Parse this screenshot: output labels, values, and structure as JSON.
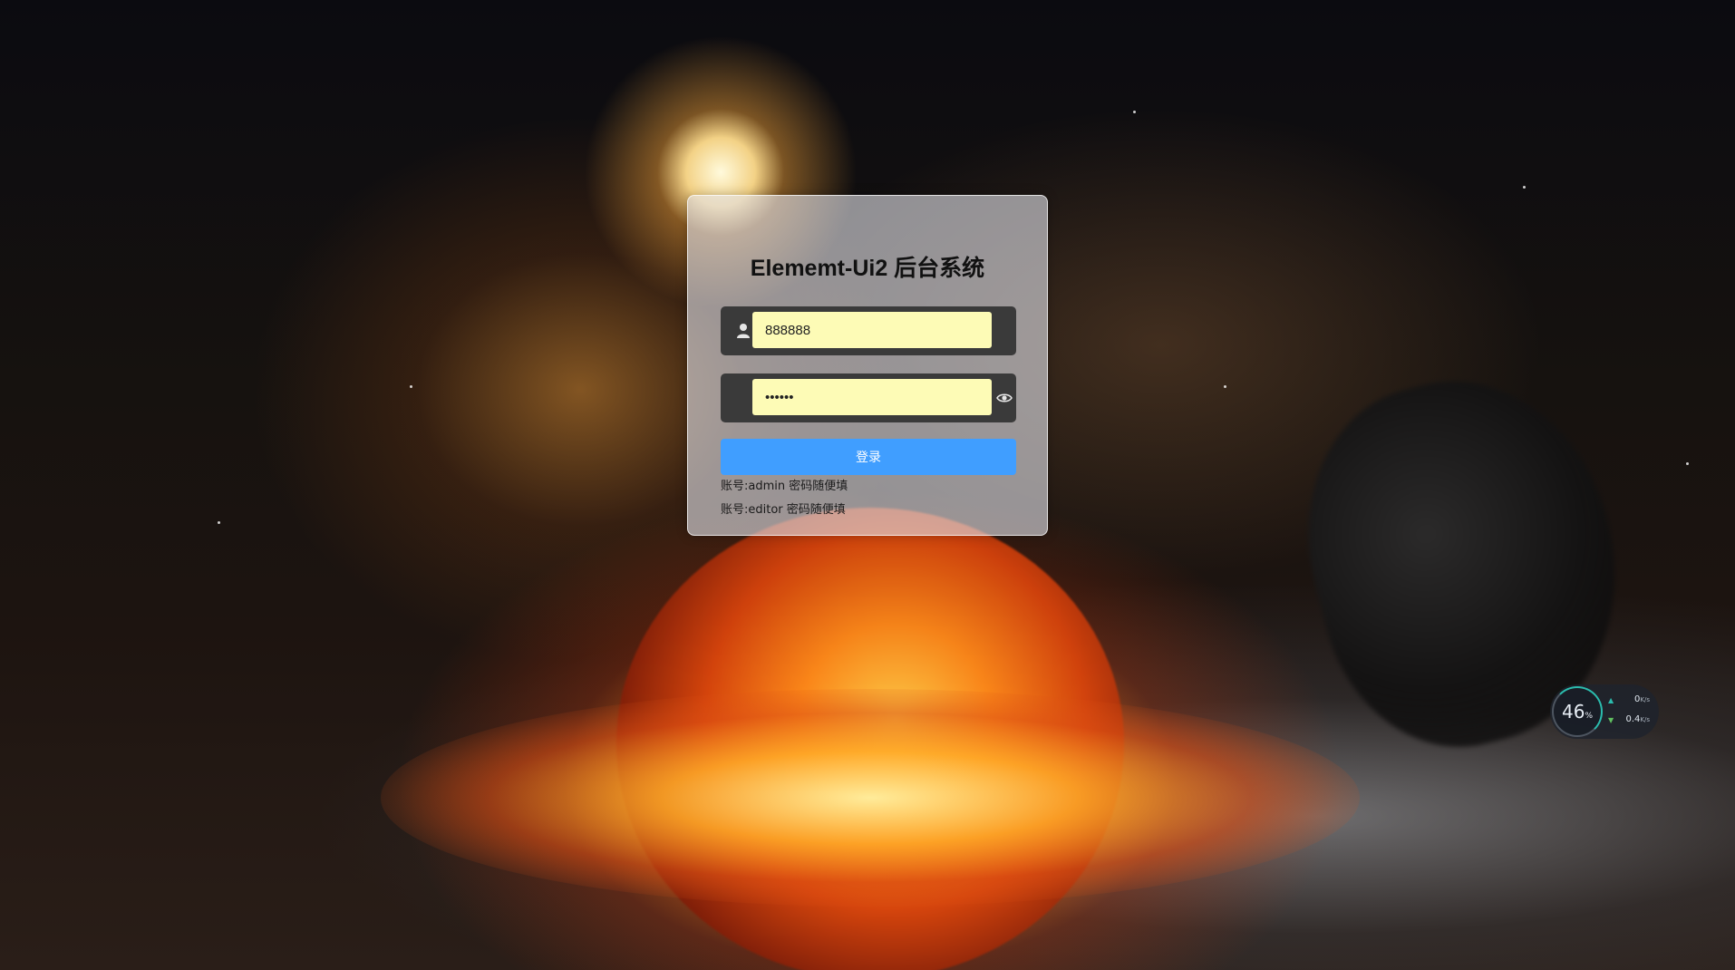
{
  "login": {
    "title": "Elememt-Ui2 后台系统",
    "username": {
      "value": "888888",
      "icon": "user-icon"
    },
    "password": {
      "value": "••••••",
      "icon": "eye-icon"
    },
    "submit_label": "登录",
    "hints": [
      "账号:admin 密码随便填",
      "账号:editor 密码随便填"
    ]
  },
  "network_widget": {
    "usage_value": "46",
    "usage_unit": "%",
    "upload_value": "0",
    "upload_unit": "K/s",
    "download_value": "0.4",
    "download_unit": "K/s"
  },
  "colors": {
    "accent": "#409eff",
    "input_background": "#fdfbb6",
    "field_background": "#3a3a3a"
  }
}
